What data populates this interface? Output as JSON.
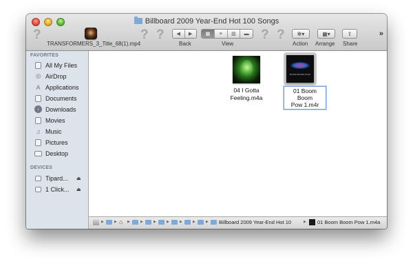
{
  "window": {
    "title": "Billboard 2009 Year-End Hot 100 Songs"
  },
  "toolbar": {
    "unknown_glyph": "?",
    "shortcut_file": "TRANSFORMERS_3_Title_68(1).mp4",
    "back_label": "Back",
    "view_label": "View",
    "action_label": "Action",
    "arrange_label": "Arrange",
    "share_label": "Share",
    "overflow": "»",
    "back_glyph": "◀",
    "forward_glyph": "▶",
    "view_modes": [
      {
        "icon": "icon-view-icon",
        "glyph": "▦",
        "active": true
      },
      {
        "icon": "list-view-icon",
        "glyph": "≡",
        "active": false
      },
      {
        "icon": "column-view-icon",
        "glyph": "▥",
        "active": false
      },
      {
        "icon": "cover-flow-icon",
        "glyph": "▬",
        "active": false
      }
    ],
    "action_glyph": "✻▾",
    "arrange_glyph": "▦▾",
    "share_glyph": "⇪"
  },
  "sidebar": {
    "favorites_heading": "FAVORITES",
    "favorites": [
      {
        "label": "All My Files",
        "icon": "all-files-icon"
      },
      {
        "label": "AirDrop",
        "icon": "airdrop-icon"
      },
      {
        "label": "Applications",
        "icon": "applications-icon"
      },
      {
        "label": "Documents",
        "icon": "documents-icon"
      },
      {
        "label": "Downloads",
        "icon": "downloads-icon"
      },
      {
        "label": "Movies",
        "icon": "movies-icon"
      },
      {
        "label": "Music",
        "icon": "music-icon"
      },
      {
        "label": "Pictures",
        "icon": "pictures-icon"
      },
      {
        "label": "Desktop",
        "icon": "desktop-icon"
      }
    ],
    "devices_heading": "DEVICES",
    "devices": [
      {
        "label": "Tipard...",
        "icon": "drive-icon"
      },
      {
        "label": "1 Click...",
        "icon": "drive-icon"
      }
    ],
    "eject_glyph": "⏏"
  },
  "files": [
    {
      "name_line1": "04 I Gotta",
      "name_line2": "Feeling.m4a",
      "selected": false
    },
    {
      "name_line1": "01 Boom Boom",
      "name_line2": "Pow 1.m4r",
      "selected": true,
      "renaming": true
    }
  ],
  "pathbar": {
    "segment_count": 9,
    "folder_label": "Billboard 2009 Year-End Hot 10",
    "file_label": "01 Boom Boom Pow 1.m4a",
    "arrow": "▶"
  },
  "colors": {
    "sidebar_bg": "#dde3ea",
    "selection_outline": "#7aa1d7",
    "folder_blue": "#7ea9d8"
  }
}
